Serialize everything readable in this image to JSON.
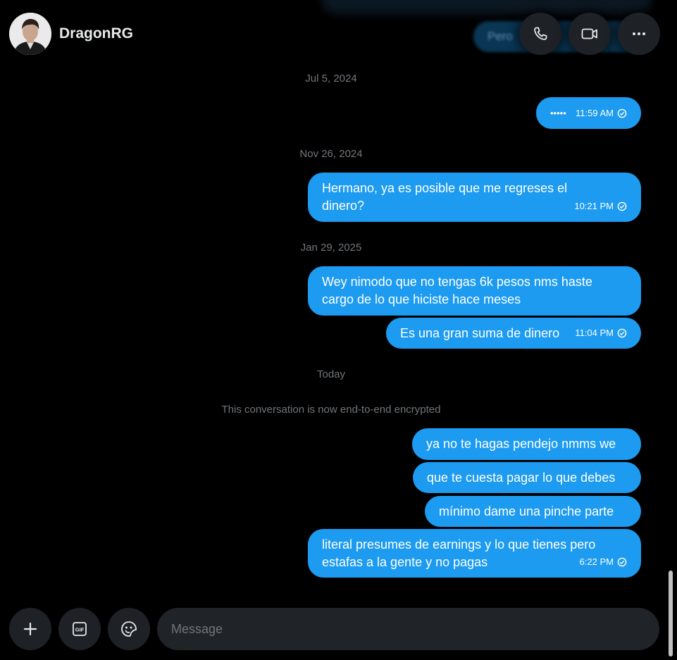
{
  "header": {
    "contact_name": "DragonRG",
    "ghost_text": "Pero"
  },
  "conversation": [
    {
      "type": "date",
      "text": "Jul 5, 2024"
    },
    {
      "type": "message",
      "text": "•••••",
      "time": "11:59 AM"
    },
    {
      "type": "date",
      "text": "Nov 26, 2024"
    },
    {
      "type": "message",
      "text": "Hermano, ya es posible que me regreses el dinero?",
      "time": "10:21 PM"
    },
    {
      "type": "date",
      "text": "Jan 29, 2025"
    },
    {
      "type": "message",
      "text": "Wey nimodo que no tengas 6k pesos nms haste cargo de lo que hiciste hace meses"
    },
    {
      "type": "message",
      "text": "Es una gran suma de dinero",
      "time": "11:04 PM"
    },
    {
      "type": "date",
      "text": "Today"
    },
    {
      "type": "notice",
      "text": "This conversation is now end-to-end encrypted"
    },
    {
      "type": "message",
      "text": "ya no te hagas pendejo nmms we"
    },
    {
      "type": "message",
      "text": "que te cuesta pagar lo que debes"
    },
    {
      "type": "message",
      "text": "mínimo dame una pinche parte"
    },
    {
      "type": "message",
      "text": "literal presumes de earnings y lo que tienes pero estafas a la gente y no pagas",
      "time": "6:22 PM"
    }
  ],
  "composer": {
    "placeholder": "Message"
  },
  "colors": {
    "bubble": "#1d9bf0",
    "background": "#000000",
    "button": "#1e2126"
  }
}
